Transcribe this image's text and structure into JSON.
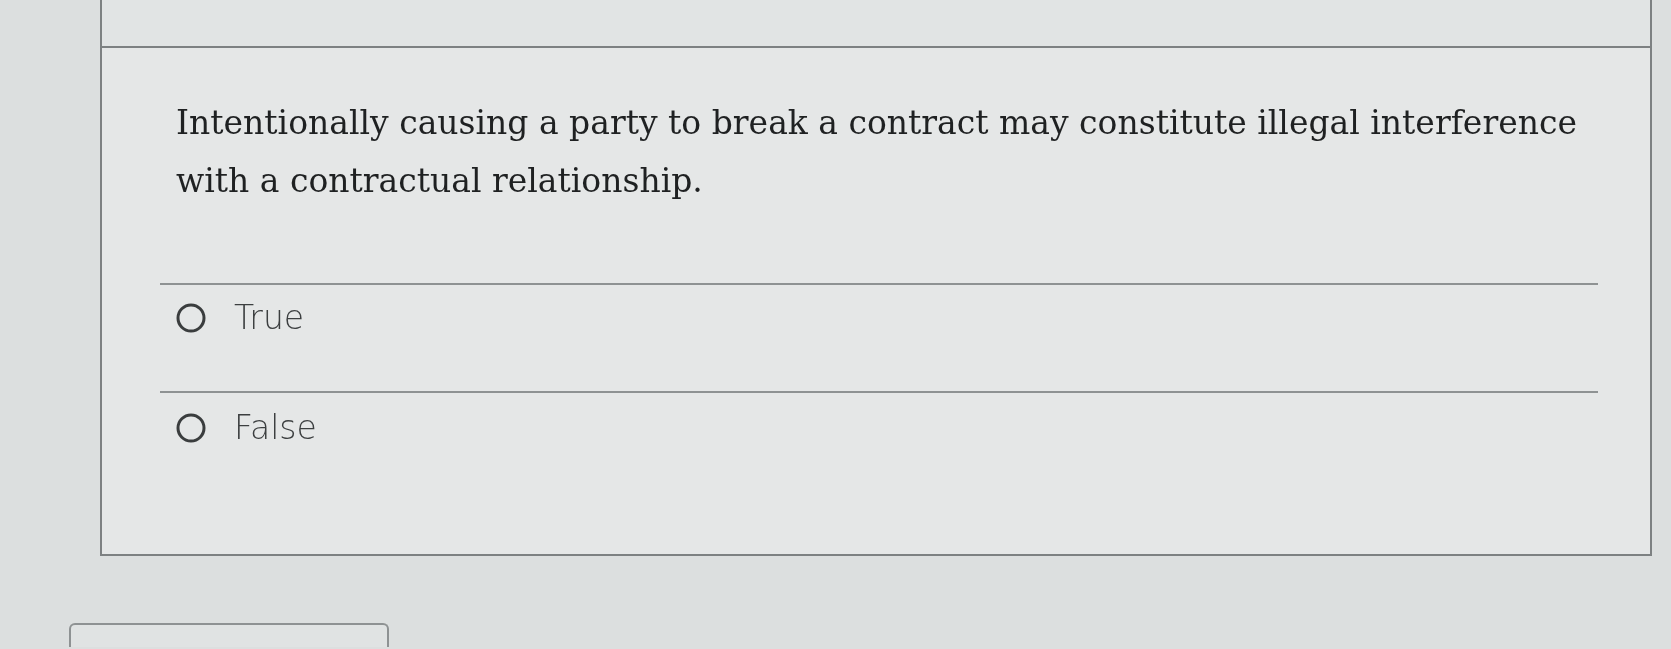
{
  "question": {
    "text": "Intentionally causing a party to break a contract may constitute illegal interference with a contractual relationship."
  },
  "answers": [
    {
      "label": "True",
      "selected": false
    },
    {
      "label": "False",
      "selected": false
    }
  ]
}
